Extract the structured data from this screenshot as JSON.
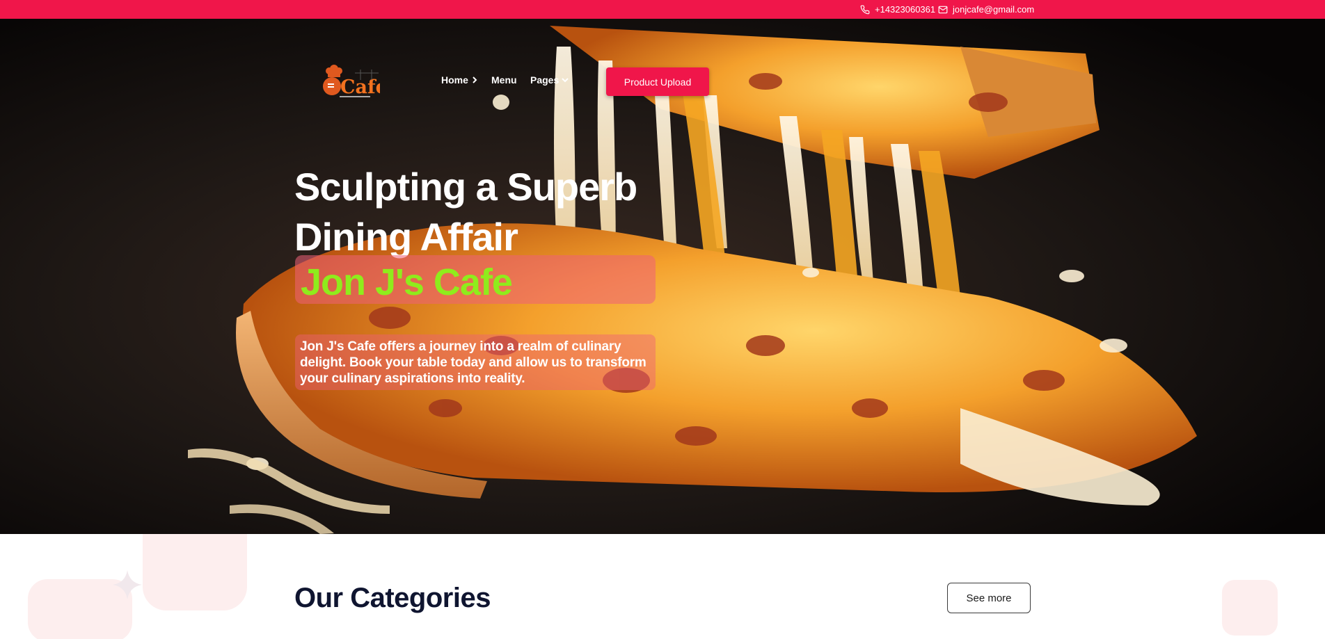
{
  "topbar": {
    "phone": "+14323060361",
    "email": "jonjcafe@gmail.com",
    "background_color": "#f0164a"
  },
  "nav": {
    "logo_text": "Cafe",
    "items": [
      {
        "label": "Home",
        "icon": "chevron-right-icon"
      },
      {
        "label": "Menu"
      },
      {
        "label": "Pages",
        "icon": "chevron-down-icon"
      }
    ],
    "upload_button": "Product Upload"
  },
  "hero": {
    "headline_line1": "Sculpting a Superb",
    "headline_line2": "Dining Affair",
    "brand": "Jon J's Cafe",
    "brand_color": "#8fec1c",
    "description": "Jon J's Cafe offers a journey into a realm of culinary delight. Book your table today and allow us to transform your culinary aspirations into reality."
  },
  "categories": {
    "title": "Our Categories",
    "see_more": "See more"
  }
}
